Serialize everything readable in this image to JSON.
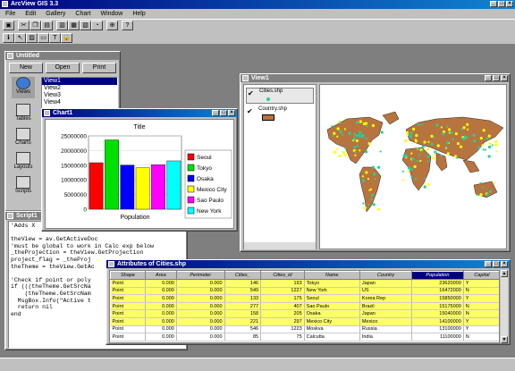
{
  "app": {
    "title": "ArcView GIS 3.3"
  },
  "menu": [
    "File",
    "Edit",
    "Gallery",
    "Chart",
    "Window",
    "Help"
  ],
  "toolbar": {
    "row1": [
      "save-icon",
      "cut-icon",
      "copy-icon",
      "paste-icon",
      "chart-properties-icon",
      "series-icon",
      "chart-type-icon",
      "pie-icon",
      "zoom-icon",
      "help-icon"
    ],
    "row2": [
      "info-icon",
      "pointer-icon",
      "edit-chart-icon",
      "erase-icon",
      "text-icon",
      "lock-icon"
    ]
  },
  "project": {
    "title": "Untitled",
    "new": "New",
    "open": "Open",
    "print": "Print",
    "views": [
      "View1",
      "View2",
      "View3",
      "View4"
    ],
    "side": [
      "Views",
      "Tables",
      "Charts",
      "Layouts",
      "Scripts"
    ]
  },
  "chart": {
    "window_title": "Chart1"
  },
  "chart_data": {
    "type": "bar",
    "title": "Title",
    "xlabel": "Population",
    "categories": [
      "Seoul",
      "Tokyo",
      "Osaka",
      "Mexico City",
      "Sao Paulo",
      "New York"
    ],
    "values": [
      15850000,
      23620000,
      15040000,
      14100000,
      15175000,
      16472000
    ],
    "colors": [
      "#ff0000",
      "#00e000",
      "#0000ff",
      "#ffff00",
      "#ff00ff",
      "#00ffff"
    ],
    "yticks": [
      "25000000",
      "20000000",
      "15000000",
      "10000000",
      "5000000",
      "0"
    ],
    "ylim": [
      0,
      25000000
    ],
    "legend": "right"
  },
  "view": {
    "title": "View1",
    "layers": [
      {
        "name": "Cities.shp",
        "checked": "✔"
      },
      {
        "name": "Country.shp",
        "checked": "✔"
      }
    ]
  },
  "script": {
    "title": "Script1",
    "lines": [
      "'Adds X",
      "",
      "theView = av.GetActiveDoc",
      "'must be global to work in Calc exp below",
      "_theProjection = theView.GetProjection",
      "project_flag = _theProj",
      "theTheme = theView.GetAc",
      "",
      "'Check if point or poly",
      "if (((theTheme.GetSrcNa",
      "    (theTheme.GetSrcNam",
      "  MsgBox.Info(\"Active t",
      "  return nil",
      "end"
    ]
  },
  "table": {
    "title": "Attributes of Cities.shp",
    "columns": [
      "Shape",
      "Area",
      "Perimeter",
      "Cities_",
      "Cities_id",
      "Name",
      "Country",
      "Population",
      "Capital"
    ],
    "rows": [
      {
        "hl": true,
        "cells": [
          "Point",
          "0.000",
          "0.000",
          "146",
          "193",
          "Tokyo",
          "Japan",
          "23620000",
          "Y"
        ]
      },
      {
        "hl": true,
        "cells": [
          "Point",
          "0.000",
          "0.000",
          "549",
          "1227",
          "New York",
          "US",
          "16472000",
          "N"
        ]
      },
      {
        "hl": true,
        "cells": [
          "Point",
          "0.000",
          "0.000",
          "133",
          "175",
          "Seoul",
          "Korea Rep",
          "15850000",
          "Y"
        ]
      },
      {
        "hl": true,
        "cells": [
          "Point",
          "0.000",
          "0.000",
          "277",
          "407",
          "Sao Paulo",
          "Brazil",
          "15175000",
          "N"
        ]
      },
      {
        "hl": true,
        "cells": [
          "Point",
          "0.000",
          "0.000",
          "158",
          "205",
          "Osaka",
          "Japan",
          "15040000",
          "N"
        ]
      },
      {
        "hl": true,
        "cells": [
          "Point",
          "0.000",
          "0.000",
          "221",
          "297",
          "Mexico City",
          "Mexico",
          "14100000",
          "Y"
        ]
      },
      {
        "hl": false,
        "cells": [
          "Point",
          "0.000",
          "0.000",
          "546",
          "1223",
          "Moskva",
          "Russia",
          "13100000",
          "Y"
        ]
      },
      {
        "hl": false,
        "cells": [
          "Point",
          "0.000",
          "0.000",
          "85",
          "75",
          "Calcutta",
          "India",
          "11100000",
          "N"
        ]
      }
    ]
  }
}
